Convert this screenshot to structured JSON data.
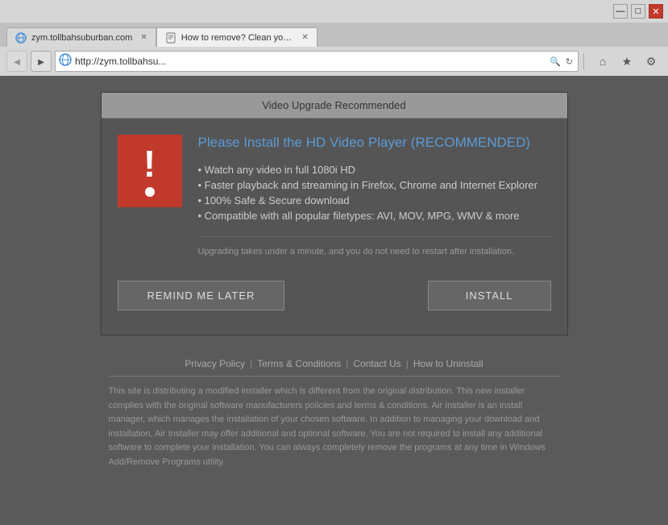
{
  "browser": {
    "title_bar": {
      "minimize_label": "—",
      "maximize_label": "□",
      "close_label": "✕"
    },
    "tabs": [
      {
        "id": "tab1",
        "label": "zym.tollbahsuburban.com",
        "active": false,
        "icon": "globe-icon"
      },
      {
        "id": "tab2",
        "label": "How to remove? Clean your co...",
        "active": true,
        "icon": "page-icon"
      }
    ],
    "address_bar": {
      "url": "http://zym.tollbahsu...",
      "full_url": "zym.tollbahsuburban.com",
      "refresh_label": "↻",
      "stop_label": "✕"
    },
    "nav": {
      "back_label": "◄",
      "forward_label": "►"
    },
    "toolbar": {
      "home_label": "⌂",
      "favorites_label": "★",
      "settings_label": "⚙"
    }
  },
  "popup": {
    "header": "Video Upgrade Recommended",
    "warning_icon": "!",
    "title_plain": "Please Install the HD Video Player",
    "title_highlighted": "(RECOMMENDED)",
    "bullets": [
      "Watch any video in full 1080i HD",
      "Faster playback and streaming in Firefox, Chrome and Internet Explorer",
      "100% Safe & Secure download",
      "Compatible with all popular filetypes: AVI, MOV,  MPG, WMV & more"
    ],
    "note": "Upgrading takes under a minute, and you do not need to restart after installation.",
    "remind_label": "REMIND ME LATER",
    "install_label": "INSTALL"
  },
  "footer": {
    "links": [
      {
        "label": "Privacy Policy",
        "id": "privacy"
      },
      {
        "label": "Terms & Conditions",
        "id": "terms"
      },
      {
        "label": "Contact Us",
        "id": "contact"
      },
      {
        "label": "How to Uninstall",
        "id": "uninstall"
      }
    ],
    "disclaimer": "This site is distributing a modified installer which is different from the original distribution. This new installer complies with the original software manufacturers policies and terms & conditions. Air Installer is an install manager, which manages the installation of your chosen software. In addition to managing your download and installation, Air Installer may offer additional and optional software. You are not required to install any additional software to complete your installation. You can always completely remove the programs at any time in Windows Add/Remove Programs utility."
  }
}
